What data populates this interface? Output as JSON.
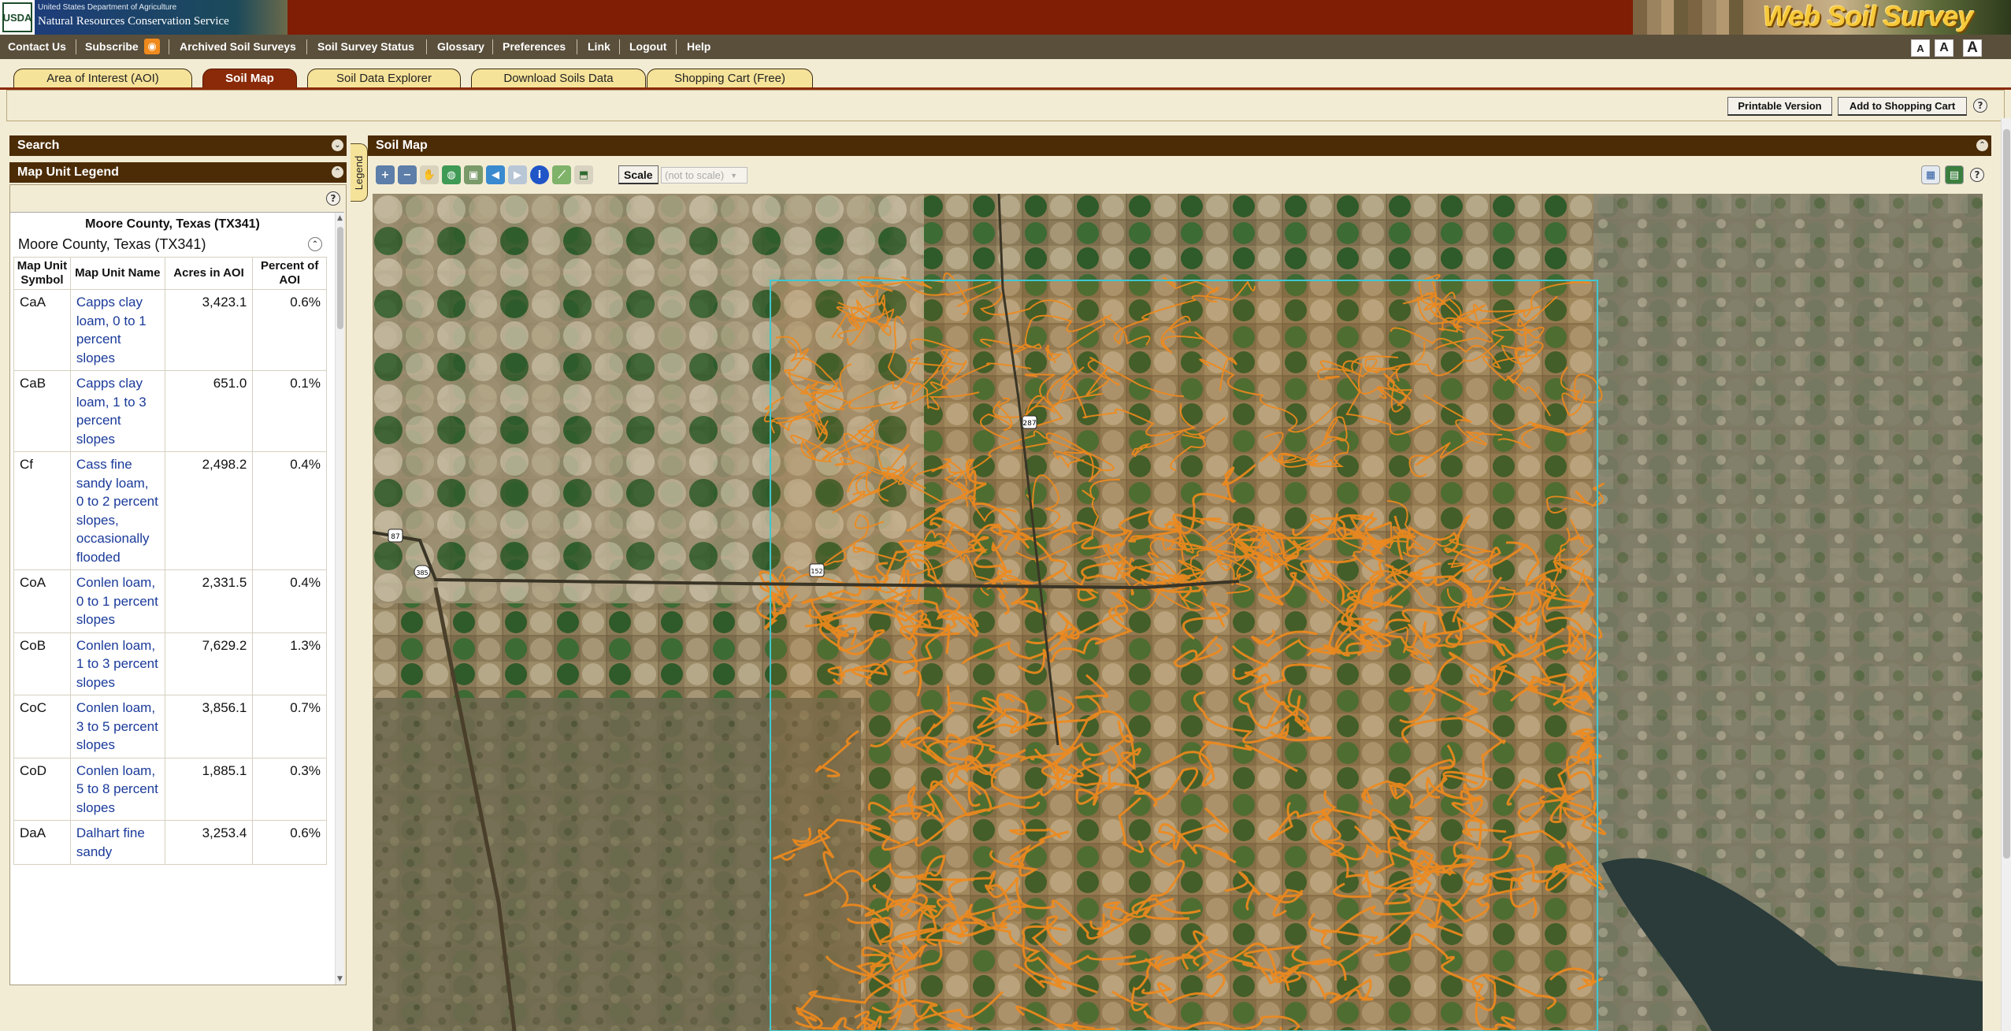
{
  "header": {
    "agency_mark": "USDA",
    "agency_line1": "United States Department of Agriculture",
    "agency_line2": "Natural Resources Conservation Service",
    "app_title": "Web Soil Survey"
  },
  "nav": {
    "items": [
      "Contact Us",
      "Subscribe",
      "Archived Soil Surveys",
      "Soil Survey Status",
      "Glossary",
      "Preferences",
      "Link",
      "Logout",
      "Help"
    ],
    "font_sizes": [
      "A",
      "A",
      "A"
    ]
  },
  "tabs": [
    {
      "label": "Area of Interest (AOI)",
      "active": false
    },
    {
      "label": "Soil Map",
      "active": true
    },
    {
      "label": "Soil Data Explorer",
      "active": false
    },
    {
      "label": "Download Soils Data",
      "active": false
    },
    {
      "label": "Shopping Cart (Free)",
      "active": false
    }
  ],
  "actions": {
    "printable": "Printable Version",
    "add_cart": "Add to Shopping Cart",
    "help": "?"
  },
  "left": {
    "search_title": "Search",
    "legend_title": "Map Unit Legend",
    "side_tab": "Legend",
    "area_title": "Moore County, Texas (TX341)",
    "area_subtitle": "Moore County, Texas (TX341)",
    "columns": [
      "Map Unit Symbol",
      "Map Unit Name",
      "Acres in AOI",
      "Percent of AOI"
    ],
    "rows": [
      {
        "symbol": "CaA",
        "name": "Capps clay loam, 0 to 1 percent slopes",
        "acres": "3,423.1",
        "percent": "0.6%"
      },
      {
        "symbol": "CaB",
        "name": "Capps clay loam, 1 to 3 percent slopes",
        "acres": "651.0",
        "percent": "0.1%"
      },
      {
        "symbol": "Cf",
        "name": "Cass fine sandy loam, 0 to 2 percent slopes, occasionally flooded",
        "acres": "2,498.2",
        "percent": "0.4%"
      },
      {
        "symbol": "CoA",
        "name": "Conlen loam, 0 to 1 percent slopes",
        "acres": "2,331.5",
        "percent": "0.4%"
      },
      {
        "symbol": "CoB",
        "name": "Conlen loam, 1 to 3 percent slopes",
        "acres": "7,629.2",
        "percent": "1.3%"
      },
      {
        "symbol": "CoC",
        "name": "Conlen loam, 3 to 5 percent slopes",
        "acres": "3,856.1",
        "percent": "0.7%"
      },
      {
        "symbol": "CoD",
        "name": "Conlen loam, 5 to 8 percent slopes",
        "acres": "1,885.1",
        "percent": "0.3%"
      },
      {
        "symbol": "DaA",
        "name": "Dalhart fine sandy",
        "acres": "3,253.4",
        "percent": "0.6%"
      }
    ]
  },
  "map": {
    "title": "Soil Map",
    "scale_label": "Scale",
    "scale_value": "(not to scale)",
    "route_shields": [
      "287",
      "87",
      "385",
      "152"
    ]
  },
  "colors": {
    "header_red": "#7f1d05",
    "nav_brown": "#5a4f3b",
    "panel_dark": "#4c2c06",
    "tab_active": "#8a2a08",
    "tab_inactive": "#f6e39a",
    "soil_lines": "#f08a1c",
    "aoi_border": "#3fc7d0",
    "page_bg": "#f3ecd5"
  }
}
